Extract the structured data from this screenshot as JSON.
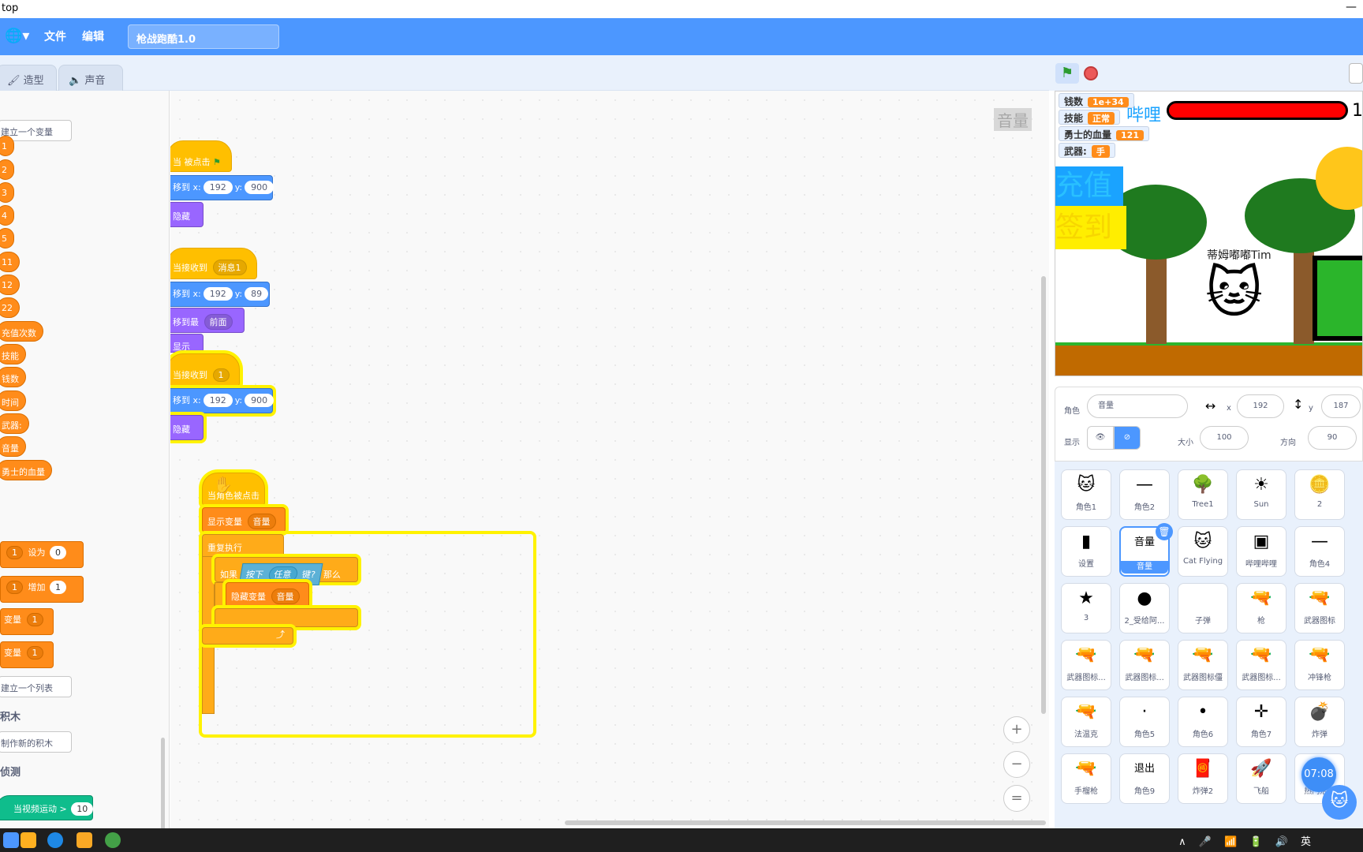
{
  "window": {
    "title": "top",
    "minimize": "—"
  },
  "menubar": {
    "globe_icon": "globe-icon",
    "file": "文件",
    "edit": "编辑",
    "project_title": "枪战跑酷1.0"
  },
  "tabs": {
    "costumes": "造型",
    "sounds": "声音"
  },
  "palette": {
    "make_variable": "建立一个变量",
    "variables": [
      "1",
      "2",
      "3",
      "4",
      "5",
      "11",
      "12",
      "22",
      "充值次数",
      "技能",
      "钱数",
      "时间",
      "武器:",
      "音量",
      "勇士的血量"
    ],
    "set_block": {
      "var": "1",
      "label": "设为",
      "value": "0"
    },
    "change_block": {
      "var": "1",
      "label": "增加",
      "value": "1"
    },
    "show_var_block": {
      "label": "变量",
      "var": "1"
    },
    "hide_var_block": {
      "label": "变量",
      "var": "1"
    },
    "make_list": "建立一个列表",
    "my_blocks_head": "积木",
    "make_block": "制作新的积木",
    "sensing_head": "侦测",
    "video_block": {
      "label": "当视频运动 >",
      "value": "10"
    }
  },
  "workspace": {
    "label": "音量",
    "script1": {
      "hat": "当 被点击",
      "goto_label": "移到 x:",
      "x": "192",
      "y_label": "y:",
      "y": "900",
      "hide": "隐藏"
    },
    "script2": {
      "hat": "当接收到",
      "msg": "消息1",
      "goto_label": "移到 x:",
      "x": "192",
      "y_label": "y:",
      "y": "89",
      "front": "移到最",
      "front_opt": "前面",
      "show": "显示"
    },
    "script3": {
      "hat": "当接收到",
      "msg": "1",
      "goto_label": "移到 x:",
      "x": "192",
      "y_label": "y:",
      "y": "900",
      "hide": "隐藏"
    },
    "script4": {
      "hat": "当角色被点击",
      "show_var": "显示变量",
      "var": "音量",
      "forever": "重复执行",
      "if": "如果",
      "key_pressed": "按下",
      "key": "任意",
      "key_suffix": "键?",
      "then": "那么",
      "hide_var": "隐藏变量",
      "var2": "音量"
    }
  },
  "zoom": {
    "in": "+",
    "out": "−",
    "reset": "="
  },
  "stage": {
    "monitors": [
      {
        "label": "钱数",
        "value": "1e+34"
      },
      {
        "label": "技能",
        "value": "正常"
      },
      {
        "label": "勇士的血量",
        "value": "121"
      },
      {
        "label": "武器:",
        "value": "手"
      }
    ],
    "boss_text": "哔哩",
    "boss_number": "1",
    "recharge": "充值",
    "checkin": "签到",
    "player_name": "蒂姆嘟嘟Tim"
  },
  "sprite_info": {
    "sprite_label": "角色",
    "sprite_name": "音量",
    "x_label": "x",
    "x": "192",
    "y_label": "y",
    "y": "187",
    "show_label": "显示",
    "size_label": "大小",
    "size": "100",
    "direction_label": "方向",
    "direction": "90"
  },
  "sprites": [
    "角色1",
    "角色2",
    "Tree1",
    "Sun",
    "2",
    "设置",
    "音量",
    "Cat Flying",
    "哔哩哔哩",
    "角色4",
    "3",
    "2_受给阿...",
    "子弹",
    "枪",
    "武器图标",
    "武器图标...",
    "武器图标...",
    "武器图标僵",
    "武器图标...",
    "冲锋枪",
    "法温克",
    "角色5",
    "角色6",
    "角色7",
    "炸弹",
    "手榴枪",
    "角色9",
    "炸弹2",
    "飞船",
    "热门活..."
  ],
  "sprite_thumb_text": {
    "volume": "音量",
    "exit": "退出"
  },
  "timer": "07:08",
  "taskbar": {
    "tray": "∧ 🎤 📶 🔋 🔊 英"
  },
  "colors": {
    "accent": "#4c97ff",
    "events": "#ffbf00",
    "motion": "#4c97ff",
    "looks": "#9966ff",
    "control": "#ffab19",
    "variables": "#ff8c1a",
    "sensing": "#5cb1d6"
  }
}
